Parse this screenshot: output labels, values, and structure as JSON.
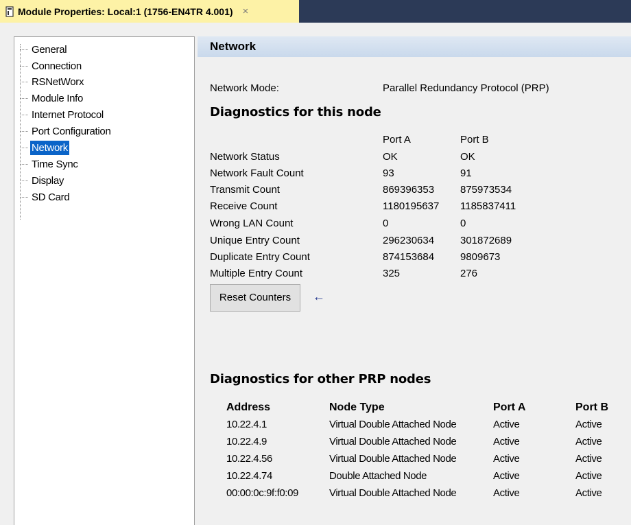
{
  "window": {
    "tab_title": "Module Properties: Local:1 (1756-EN4TR 4.001)",
    "close_glyph": "×"
  },
  "tree": {
    "items": [
      {
        "label": "General",
        "selected": false
      },
      {
        "label": "Connection",
        "selected": false
      },
      {
        "label": "RSNetWorx",
        "selected": false
      },
      {
        "label": "Module Info",
        "selected": false
      },
      {
        "label": "Internet Protocol",
        "selected": false
      },
      {
        "label": "Port Configuration",
        "selected": false
      },
      {
        "label": "Network",
        "selected": true
      },
      {
        "label": "Time Sync",
        "selected": false
      },
      {
        "label": "Display",
        "selected": false
      },
      {
        "label": "SD Card",
        "selected": false
      }
    ]
  },
  "network": {
    "section_title": "Network",
    "mode_label": "Network Mode:",
    "mode_value": "Parallel Redundancy Protocol (PRP)",
    "this_node_heading": "Diagnostics for this node",
    "port_a_header": "Port A",
    "port_b_header": "Port B",
    "rows": [
      {
        "label": "Network Status",
        "port_a": "OK",
        "port_b": "OK"
      },
      {
        "label": "Network Fault Count",
        "port_a": "93",
        "port_b": "91"
      },
      {
        "label": "Transmit Count",
        "port_a": "869396353",
        "port_b": "875973534"
      },
      {
        "label": "Receive Count",
        "port_a": "1180195637",
        "port_b": "1185837411"
      },
      {
        "label": "Wrong LAN Count",
        "port_a": "0",
        "port_b": "0"
      },
      {
        "label": "Unique Entry Count",
        "port_a": "296230634",
        "port_b": "301872689"
      },
      {
        "label": "Duplicate Entry Count",
        "port_a": "874153684",
        "port_b": "9809673"
      },
      {
        "label": "Multiple Entry Count",
        "port_a": "325",
        "port_b": "276"
      }
    ],
    "reset_button": "Reset Counters",
    "arrow_glyph": "←",
    "other_nodes_heading": "Diagnostics for other PRP nodes",
    "other_columns": {
      "address": "Address",
      "node_type": "Node Type",
      "port_a": "Port A",
      "port_b": "Port B"
    },
    "other_nodes": [
      {
        "address": "10.22.4.1",
        "node_type": "Virtual Double Attached Node",
        "port_a": "Active",
        "port_b": "Active"
      },
      {
        "address": "10.22.4.9",
        "node_type": "Virtual Double Attached Node",
        "port_a": "Active",
        "port_b": "Active"
      },
      {
        "address": "10.22.4.56",
        "node_type": "Virtual Double Attached Node",
        "port_a": "Active",
        "port_b": "Active"
      },
      {
        "address": "10.22.4.74",
        "node_type": "Double Attached Node",
        "port_a": "Active",
        "port_b": "Active"
      },
      {
        "address": "00:00:0c:9f:f0:09",
        "node_type": "Virtual Double Attached Node",
        "port_a": "Active",
        "port_b": "Active"
      }
    ]
  },
  "colors": {
    "tab_background": "#fdf2a6",
    "titlebar_background": "#2c3a57",
    "selection": "#0a64c8",
    "arrow": "#1b2f8a"
  },
  "icons": {
    "tab_icon": "module-icon",
    "arrow": "arrow-left-icon"
  }
}
